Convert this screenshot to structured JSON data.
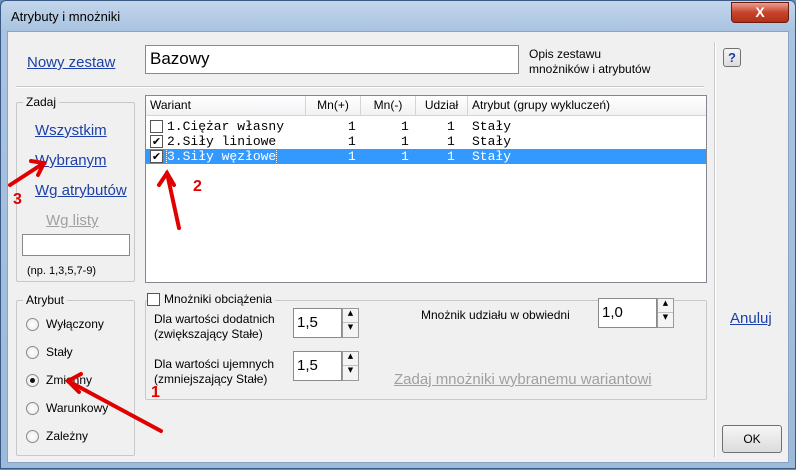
{
  "window": {
    "title": "Atrybuty i mnożniki",
    "close_label": "X"
  },
  "top": {
    "new_set_link": "Nowy zestaw",
    "set_name_value": "Bazowy",
    "set_desc_label": "Opis zestawu\nmnożników i atrybutów"
  },
  "zadaj": {
    "group_label": "Zadaj",
    "all_link": "Wszystkim",
    "selected_link": "Wybranym",
    "by_attr_link": "Wg atrybutów",
    "by_list_link": "Wg listy",
    "list_input_value": "",
    "list_hint": "(np. 1,3,5,7-9)"
  },
  "atrybut": {
    "group_label": "Atrybut",
    "options": [
      {
        "label": "Wyłączony",
        "selected": false
      },
      {
        "label": "Stały",
        "selected": false
      },
      {
        "label": "Zmienny",
        "selected": true
      },
      {
        "label": "Warunkowy",
        "selected": false
      },
      {
        "label": "Zależny",
        "selected": false
      }
    ]
  },
  "list": {
    "columns": [
      "Wariant",
      "Mn(+)",
      "Mn(-)",
      "Udział",
      "Atrybut (grupy wykluczeń)"
    ],
    "rows": [
      {
        "checked": false,
        "name": "1.Ciężar własny",
        "mn_plus": "1",
        "mn_minus": "1",
        "udzial": "1",
        "atrybut": "Stały",
        "selected": false
      },
      {
        "checked": true,
        "name": "2.Siły liniowe",
        "mn_plus": "1",
        "mn_minus": "1",
        "udzial": "1",
        "atrybut": "Stały",
        "selected": false
      },
      {
        "checked": true,
        "name": "3.Siły węzłowe",
        "mn_plus": "1",
        "mn_minus": "1",
        "udzial": "1",
        "atrybut": "Stały",
        "selected": true
      }
    ]
  },
  "multipliers": {
    "checkbox_label": "Mnożniki obciążenia",
    "checked": false,
    "positive_label": "Dla wartości dodatnich\n(zwiększający Stałe)",
    "positive_value": "1,5",
    "negative_label": "Dla wartości ujemnych\n(zmniejszający Stałe)",
    "negative_value": "1,5",
    "envelope_label": "Mnożnik udziału w obwiedni",
    "envelope_value": "1,0",
    "apply_link": "Zadaj mnożniki wybranemu wariantowi"
  },
  "right": {
    "help_label": "?",
    "cancel_link": "Anuluj",
    "ok_label": "OK"
  },
  "annotations": [
    "1",
    "2",
    "3"
  ],
  "colors": {
    "selection": "#3399ff",
    "link": "#1c3fa8",
    "annotation": "#e00000"
  }
}
